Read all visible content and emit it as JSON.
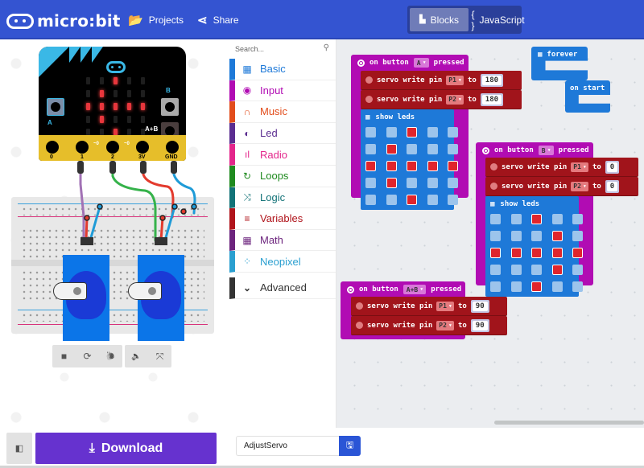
{
  "header": {
    "logo_text": "micro:bit",
    "projects_label": "Projects",
    "share_label": "Share",
    "modes": [
      {
        "label": "Blocks",
        "active": true
      },
      {
        "label": "JavaScript",
        "active": false
      }
    ],
    "js_icon": "{ }"
  },
  "simulator": {
    "button_labels": {
      "a": "A",
      "b": "B",
      "ab": "A+B"
    },
    "pins": [
      "0",
      "1",
      "2",
      "3V",
      "GND"
    ],
    "pin_pwm_marks": [
      "~0",
      "~0"
    ],
    "led_matrix": [
      [
        0,
        0,
        1,
        0,
        0
      ],
      [
        0,
        1,
        0,
        0,
        0
      ],
      [
        1,
        1,
        1,
        1,
        1
      ],
      [
        0,
        1,
        0,
        0,
        0
      ],
      [
        0,
        0,
        1,
        0,
        0
      ]
    ],
    "controls": [
      {
        "icon": "stop-icon",
        "glyph": "■"
      },
      {
        "icon": "restart-icon",
        "glyph": "⟳"
      },
      {
        "icon": "slow-motion-icon",
        "glyph": "🐌"
      },
      {
        "icon": "mute-icon",
        "glyph": "🔈"
      },
      {
        "icon": "fullscreen-icon",
        "glyph": "⤧"
      }
    ]
  },
  "toolbox": {
    "search_placeholder": "Search...",
    "categories": [
      {
        "label": "Basic",
        "color": "#1e79d8",
        "glyph": "▦"
      },
      {
        "label": "Input",
        "color": "#b10cb3",
        "glyph": "◉"
      },
      {
        "label": "Music",
        "color": "#e24d1c",
        "glyph": "∩"
      },
      {
        "label": "Led",
        "color": "#5b2d90",
        "glyph": "◐"
      },
      {
        "label": "Radio",
        "color": "#e3268b",
        "glyph": "ıl"
      },
      {
        "label": "Loops",
        "color": "#1f8a1f",
        "glyph": "↻"
      },
      {
        "label": "Logic",
        "color": "#127277",
        "glyph": "⤨"
      },
      {
        "label": "Variables",
        "color": "#b0141b",
        "glyph": "≡"
      },
      {
        "label": "Math",
        "color": "#6c247d",
        "glyph": "▦"
      },
      {
        "label": "Neopixel",
        "color": "#2a9fd0",
        "glyph": "⁘"
      }
    ],
    "advanced_label": "Advanced"
  },
  "workspace": {
    "event_blocks": [
      {
        "prefix": "on button",
        "button": "A",
        "suffix": "pressed",
        "servos": [
          {
            "text": "servo write pin",
            "pin": "P1",
            "to": "to",
            "value": "180"
          },
          {
            "text": "servo write pin",
            "pin": "P2",
            "to": "to",
            "value": "180"
          }
        ],
        "show_leds": {
          "label": "show leds",
          "grid": [
            [
              0,
              0,
              1,
              0,
              0
            ],
            [
              0,
              1,
              0,
              0,
              0
            ],
            [
              1,
              1,
              1,
              1,
              1
            ],
            [
              0,
              1,
              0,
              0,
              0
            ],
            [
              0,
              0,
              1,
              0,
              0
            ]
          ]
        }
      },
      {
        "prefix": "on button",
        "button": "B",
        "suffix": "pressed",
        "servos": [
          {
            "text": "servo write pin",
            "pin": "P1",
            "to": "to",
            "value": "0"
          },
          {
            "text": "servo write pin",
            "pin": "P2",
            "to": "to",
            "value": "0"
          }
        ],
        "show_leds": {
          "label": "show leds",
          "grid": [
            [
              0,
              0,
              1,
              0,
              0
            ],
            [
              0,
              0,
              0,
              1,
              0
            ],
            [
              1,
              1,
              1,
              1,
              1
            ],
            [
              0,
              0,
              0,
              1,
              0
            ],
            [
              0,
              0,
              1,
              0,
              0
            ]
          ]
        }
      },
      {
        "prefix": "on button",
        "button": "A+B",
        "suffix": "pressed",
        "servos": [
          {
            "text": "servo write pin",
            "pin": "P1",
            "to": "to",
            "value": "90"
          },
          {
            "text": "servo write pin",
            "pin": "P2",
            "to": "to",
            "value": "90"
          }
        ]
      }
    ],
    "forever_label": "forever",
    "on_start_label": "on start"
  },
  "footer": {
    "download_label": "Download",
    "project_name": "AdjustServo"
  }
}
